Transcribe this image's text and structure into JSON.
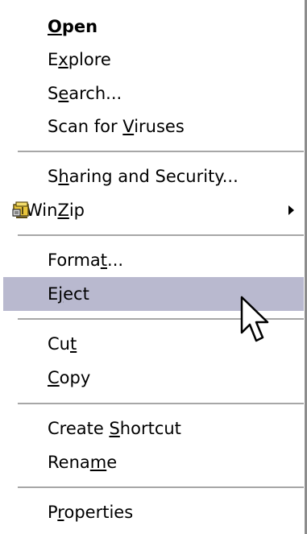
{
  "menu": {
    "items": [
      {
        "pre": "",
        "key": "O",
        "post": "pen"
      },
      {
        "pre": "E",
        "key": "x",
        "post": "plore"
      },
      {
        "pre": "S",
        "key": "e",
        "post": "arch..."
      },
      {
        "pre": "Scan for ",
        "key": "V",
        "post": "iruses"
      },
      {
        "pre": "S",
        "key": "h",
        "post": "aring and Security..."
      },
      {
        "pre": "Win",
        "key": "Z",
        "post": "ip"
      },
      {
        "pre": "Forma",
        "key": "t",
        "post": "..."
      },
      {
        "pre": "E",
        "key": "j",
        "post": "ect"
      },
      {
        "pre": "Cu",
        "key": "t",
        "post": ""
      },
      {
        "pre": "",
        "key": "C",
        "post": "opy"
      },
      {
        "pre": "Create ",
        "key": "S",
        "post": "hortcut"
      },
      {
        "pre": "Rena",
        "key": "m",
        "post": "e"
      },
      {
        "pre": "P",
        "key": "r",
        "post": "operties"
      }
    ],
    "highlighted_item": "Eject",
    "default_item": "Open"
  },
  "icons": {
    "winzip": "winzip-icon",
    "submenu_arrow": "submenu-arrow-icon",
    "cursor": "mouse-pointer-icon"
  },
  "colors": {
    "highlight": "#b9b9cf",
    "separator": "#a7a7a7",
    "text": "#000000"
  }
}
